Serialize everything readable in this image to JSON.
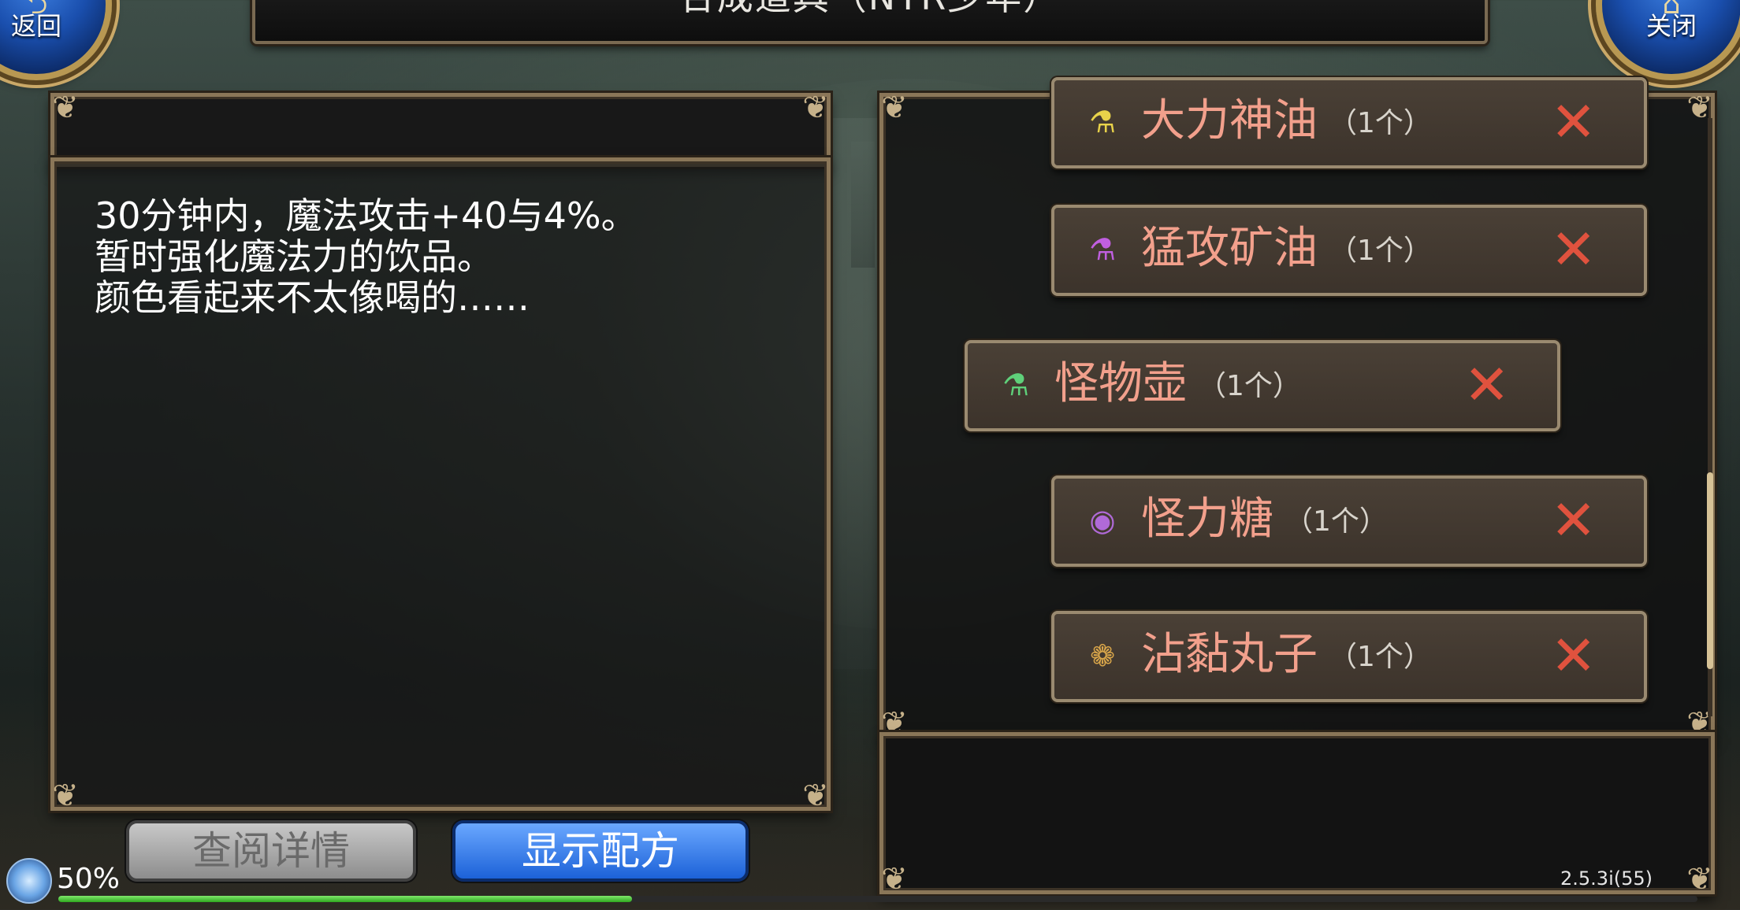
{
  "header": {
    "title": "合成道具（NTR少年）"
  },
  "nav": {
    "back_label": "返回",
    "close_label": "关闭"
  },
  "description": {
    "lines": [
      "30分钟内，魔法攻击+40与4%。",
      "暂时强化魔法力的饮品。",
      "颜色看起来不太像喝的……"
    ]
  },
  "ingredients": [
    {
      "name": "大力神油",
      "qty": "（1个）",
      "icon": "yellow-potion-icon"
    },
    {
      "name": "猛攻矿油",
      "qty": "（1个）",
      "icon": "purple-potion-icon"
    },
    {
      "name": "怪物壶",
      "qty": "（1个）",
      "icon": "green-potion-icon"
    },
    {
      "name": "怪力糖",
      "qty": "（1个）",
      "icon": "purple-orb-icon"
    },
    {
      "name": "沾黏丸子",
      "qty": "（1个）",
      "icon": "dumpling-icon"
    }
  ],
  "delete_glyph": "✕",
  "buttons": {
    "view_details": "查阅详情",
    "show_recipe": "显示配方"
  },
  "status": {
    "progress_text": "50%",
    "progress": 0.35,
    "version": "2.5.3i(55)"
  },
  "colors": {
    "item_name": "#f2a08c",
    "delete": "#e0523e",
    "accent_blue": "#1c62d8"
  }
}
